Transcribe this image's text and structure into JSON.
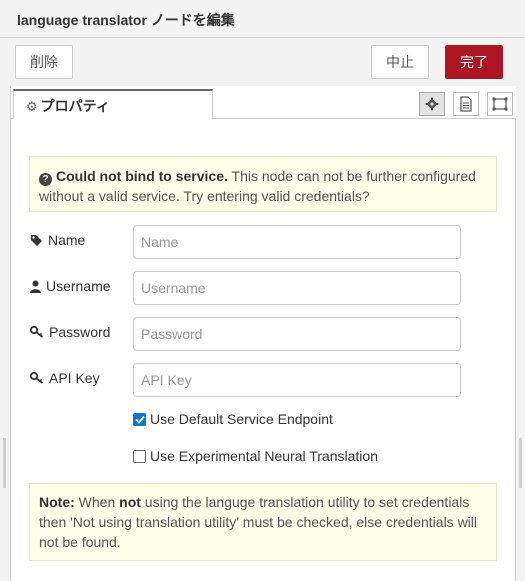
{
  "window": {
    "title": "language translator ノードを編集"
  },
  "actions": {
    "delete_label": "削除",
    "cancel_label": "中止",
    "done_label": "完了"
  },
  "tabs": [
    {
      "label": "プロパティ",
      "icon": "gear-icon"
    }
  ],
  "tab_icons": [
    "gear-icon",
    "description-icon",
    "appearance-icon"
  ],
  "warning": {
    "icon": "question-circle-icon",
    "bold": "Could not bind to service.",
    "text": " This node can not be further configured without a valid service. Try entering valid credentials?"
  },
  "fields": {
    "name": {
      "label": "Name",
      "icon": "tag-icon",
      "placeholder": "Name",
      "value": ""
    },
    "username": {
      "label": "Username",
      "icon": "user-icon",
      "placeholder": "Username",
      "value": ""
    },
    "password": {
      "label": "Password",
      "icon": "key-icon",
      "placeholder": "Password",
      "value": ""
    },
    "api_key": {
      "label": "API Key",
      "icon": "key-icon",
      "placeholder": "API Key",
      "value": ""
    }
  },
  "checkboxes": {
    "default_endpoint": {
      "label": "Use Default Service Endpoint",
      "checked": true
    },
    "neural": {
      "label": "Use Experimental Neural Translation",
      "checked": false
    }
  },
  "note": {
    "label": "Note:",
    "t1": " When ",
    "bold_not": "not",
    "t2": " using the languge translation utility to set credentials then 'Not using translation utility' must be checked, else credentials will not be found."
  },
  "colors": {
    "accent": "#ad1625",
    "checkbox": "#0b75d9",
    "notice_bg": "#fefde8"
  }
}
